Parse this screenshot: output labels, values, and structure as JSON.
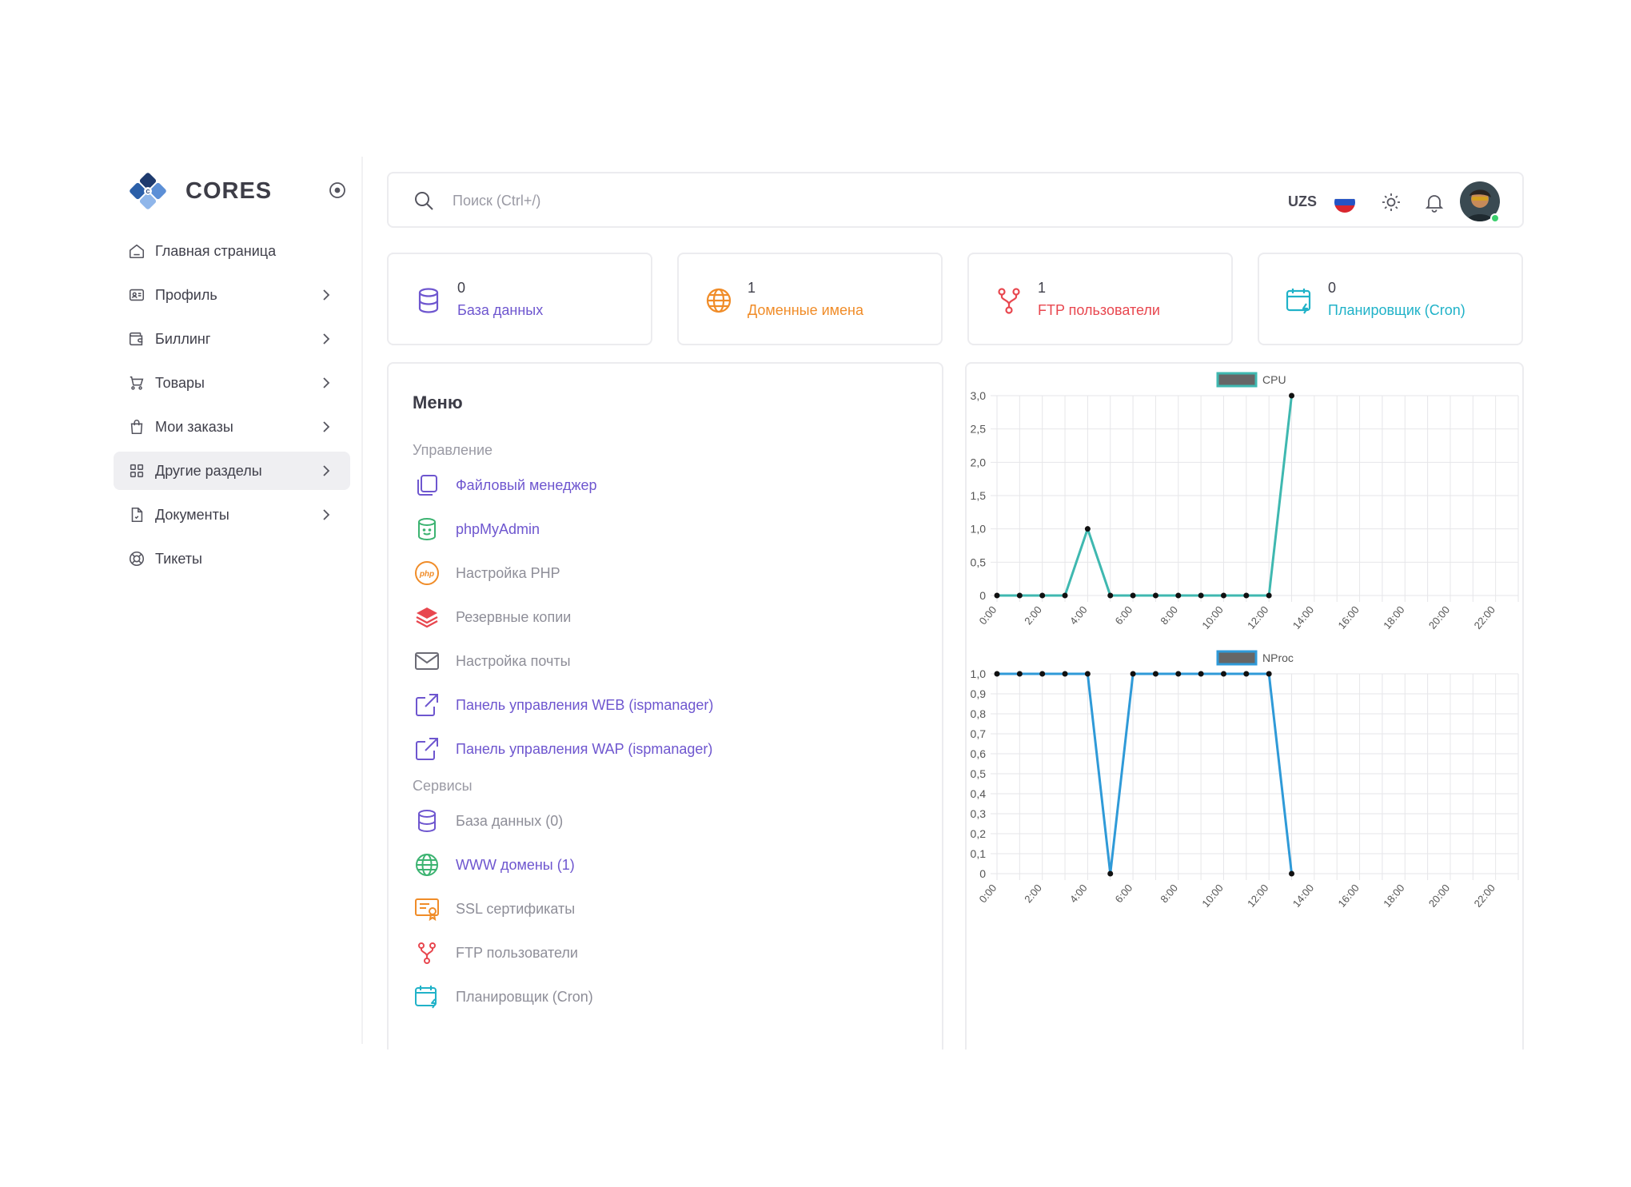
{
  "brand": {
    "name": "CORES"
  },
  "sidebar": {
    "items": [
      {
        "label": "Главная страница",
        "icon": "home-icon",
        "has_submenu": false,
        "active": false
      },
      {
        "label": "Профиль",
        "icon": "id-card-icon",
        "has_submenu": true,
        "active": false
      },
      {
        "label": "Биллинг",
        "icon": "wallet-icon",
        "has_submenu": true,
        "active": false
      },
      {
        "label": "Товары",
        "icon": "cart-icon",
        "has_submenu": true,
        "active": false
      },
      {
        "label": "Мои заказы",
        "icon": "shopping-bag-icon",
        "has_submenu": true,
        "active": false
      },
      {
        "label": "Другие разделы",
        "icon": "grid-icon",
        "has_submenu": true,
        "active": true
      },
      {
        "label": "Документы",
        "icon": "document-icon",
        "has_submenu": true,
        "active": false
      },
      {
        "label": "Тикеты",
        "icon": "lifebuoy-icon",
        "has_submenu": false,
        "active": false
      }
    ]
  },
  "topbar": {
    "search_placeholder": "Поиск (Ctrl+/)",
    "currency": "UZS",
    "language_flag": "ru-flag-icon"
  },
  "stats": [
    {
      "count": "0",
      "label": "База данных",
      "icon": "database-icon",
      "color": "#6e56cf"
    },
    {
      "count": "1",
      "label": "Доменные имена",
      "icon": "globe-icon",
      "color": "#f08c28"
    },
    {
      "count": "1",
      "label": "FTP пользователи",
      "icon": "fork-icon",
      "color": "#e8474f"
    },
    {
      "count": "0",
      "label": "Планировщик (Cron)",
      "icon": "calendar-bolt-icon",
      "color": "#20b2c8"
    }
  ],
  "menu": {
    "title": "Меню",
    "sections": {
      "management": "Управление",
      "services": "Сервисы"
    },
    "management_items": [
      {
        "label": "Файловый менеджер",
        "icon": "files-icon"
      },
      {
        "label": "phpMyAdmin",
        "icon": "database-smile-icon"
      },
      {
        "label": "Настройка PHP",
        "icon": "php-icon"
      },
      {
        "label": "Резервные копии",
        "icon": "layers-icon"
      },
      {
        "label": "Настройка почты",
        "icon": "mail-icon"
      },
      {
        "label": "Панель управления WEB (ispmanager)",
        "icon": "external-link-icon"
      },
      {
        "label": "Панель управления WAP (ispmanager)",
        "icon": "external-link-icon"
      }
    ],
    "service_items": [
      {
        "label": "База данных (0)",
        "icon": "database-icon"
      },
      {
        "label": "WWW домены (1)",
        "icon": "globe-icon"
      },
      {
        "label": "SSL сертификаты",
        "icon": "certificate-icon"
      },
      {
        "label": "FTP пользователи",
        "icon": "fork-icon"
      },
      {
        "label": "Планировщик (Cron)",
        "icon": "calendar-bolt-icon"
      }
    ]
  },
  "chart_data": [
    {
      "type": "line",
      "series": [
        {
          "name": "CPU",
          "color": "#3fb8b0",
          "x": [
            "0:00",
            "1:00",
            "2:00",
            "3:00",
            "4:00",
            "5:00",
            "6:00",
            "7:00",
            "8:00",
            "9:00",
            "10:00",
            "11:00",
            "12:00",
            "13:00"
          ],
          "values": [
            0,
            0,
            0,
            0,
            1,
            0,
            0,
            0,
            0,
            0,
            0,
            0,
            0,
            3
          ]
        }
      ],
      "x_ticks": [
        "0:00",
        "2:00",
        "4:00",
        "6:00",
        "8:00",
        "10:00",
        "12:00",
        "14:00",
        "16:00",
        "18:00",
        "20:00",
        "22:00"
      ],
      "y_ticks": [
        "0",
        "0,5",
        "1,0",
        "1,5",
        "2,0",
        "2,5",
        "3,0"
      ],
      "ylim": [
        0,
        3
      ],
      "xlim_hours": [
        0,
        23
      ],
      "grid": true,
      "legend": "top-center"
    },
    {
      "type": "line",
      "series": [
        {
          "name": "NProc",
          "color": "#2f9ad8",
          "x": [
            "0:00",
            "1:00",
            "2:00",
            "3:00",
            "4:00",
            "5:00",
            "6:00",
            "7:00",
            "8:00",
            "9:00",
            "10:00",
            "11:00",
            "12:00",
            "13:00"
          ],
          "values": [
            1,
            1,
            1,
            1,
            1,
            0,
            1,
            1,
            1,
            1,
            1,
            1,
            1,
            0
          ]
        }
      ],
      "x_ticks": [
        "0:00",
        "2:00",
        "4:00",
        "6:00",
        "8:00",
        "10:00",
        "12:00",
        "14:00",
        "16:00",
        "18:00",
        "20:00",
        "22:00"
      ],
      "y_ticks": [
        "0",
        "0,1",
        "0,2",
        "0,3",
        "0,4",
        "0,5",
        "0,6",
        "0,7",
        "0,8",
        "0,9",
        "1,0"
      ],
      "ylim": [
        0,
        1
      ],
      "xlim_hours": [
        0,
        23
      ],
      "grid": true,
      "legend": "top-center"
    }
  ]
}
